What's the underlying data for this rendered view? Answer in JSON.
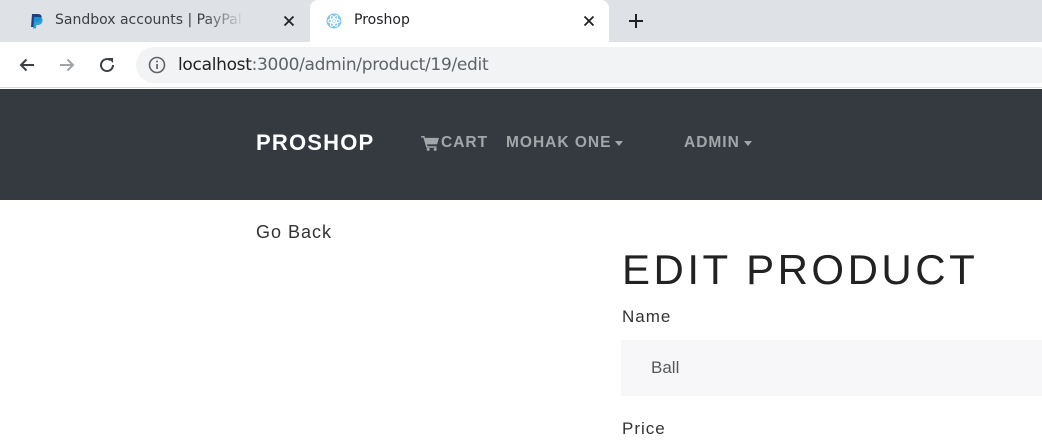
{
  "browser": {
    "tabs": [
      {
        "title": "Sandbox accounts | PayPal Developer",
        "active": false,
        "favicon": "paypal-icon"
      },
      {
        "title": "Proshop",
        "active": true,
        "favicon": "react-icon"
      }
    ],
    "url_host": "localhost",
    "url_path": ":3000/admin/product/19/edit"
  },
  "navbar": {
    "brand": "PROSHOP",
    "cart_label": "CART",
    "user_label": "MOHAK ONE",
    "admin_label": "ADMIN",
    "background": "#343a40"
  },
  "page": {
    "go_back": "Go Back",
    "title": "EDIT PRODUCT",
    "name_label": "Name",
    "name_value": "Ball",
    "price_label": "Price"
  }
}
